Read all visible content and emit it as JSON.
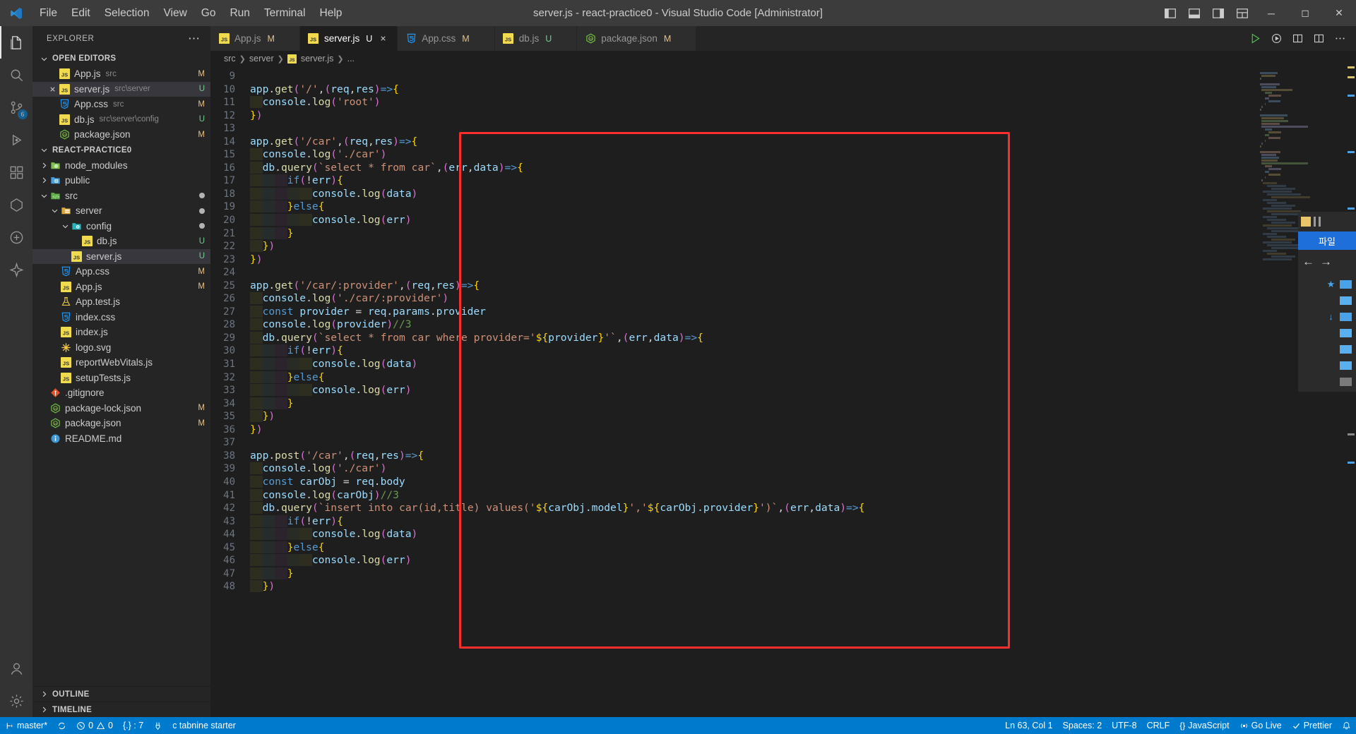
{
  "titlebar": {
    "logo_icon": "vscode-logo-icon",
    "menus": [
      "File",
      "Edit",
      "Selection",
      "View",
      "Go",
      "Run",
      "Terminal",
      "Help"
    ],
    "window_title": "server.js - react-practice0 - Visual Studio Code [Administrator]",
    "layout_icons": [
      "panel-left-icon",
      "panel-bottom-icon",
      "panel-right-icon",
      "layout-customize-icon"
    ],
    "window_controls": [
      "minimize",
      "maximize",
      "close"
    ]
  },
  "activitybar": {
    "items": [
      {
        "name": "explorer",
        "icon": "files-icon",
        "active": true,
        "badge": ""
      },
      {
        "name": "search",
        "icon": "search-icon",
        "active": false,
        "badge": ""
      },
      {
        "name": "source-control",
        "icon": "source-control-icon",
        "active": false,
        "badge": "6"
      },
      {
        "name": "run-and-debug",
        "icon": "debug-icon",
        "active": false,
        "badge": ""
      },
      {
        "name": "extensions",
        "icon": "extensions-icon",
        "active": false,
        "badge": ""
      },
      {
        "name": "remote-explorer",
        "icon": "remote-icon",
        "active": false,
        "badge": ""
      },
      {
        "name": "docker",
        "icon": "docker-icon",
        "active": false,
        "badge": ""
      },
      {
        "name": "tabnine",
        "icon": "sparkle-icon",
        "active": false,
        "badge": ""
      }
    ],
    "bottom": [
      {
        "name": "accounts",
        "icon": "account-icon"
      },
      {
        "name": "manage",
        "icon": "gear-icon"
      }
    ]
  },
  "sidebar": {
    "header": "EXPLORER",
    "more_actions": "⋯",
    "open_editors": {
      "label": "OPEN EDITORS",
      "expanded": true,
      "items": [
        {
          "name": "App.js",
          "desc": "src",
          "badge": "M",
          "badge_kind": "mod",
          "icon": "js-icon",
          "selected": false,
          "closable": false
        },
        {
          "name": "server.js",
          "desc": "src\\server",
          "badge": "U",
          "badge_kind": "unt",
          "icon": "js-icon",
          "selected": true,
          "closable": true
        },
        {
          "name": "App.css",
          "desc": "src",
          "badge": "M",
          "badge_kind": "mod",
          "icon": "css-icon",
          "selected": false,
          "closable": false
        },
        {
          "name": "db.js",
          "desc": "src\\server\\config",
          "badge": "U",
          "badge_kind": "unt",
          "icon": "js-icon",
          "selected": false,
          "closable": false
        },
        {
          "name": "package.json",
          "desc": "",
          "badge": "M",
          "badge_kind": "mod",
          "icon": "nodejs-icon",
          "selected": false,
          "closable": false
        }
      ]
    },
    "project": {
      "label": "REACT-PRACTICE0",
      "expanded": true,
      "tree": [
        {
          "name": "node_modules",
          "type": "folder",
          "indent": 1,
          "expanded": false,
          "icon": "folder-node-icon",
          "badge": ""
        },
        {
          "name": "public",
          "type": "folder",
          "indent": 1,
          "expanded": false,
          "icon": "folder-public-icon",
          "badge": ""
        },
        {
          "name": "src",
          "type": "folder",
          "indent": 1,
          "expanded": true,
          "icon": "folder-src-icon",
          "badge": "dot"
        },
        {
          "name": "server",
          "type": "folder",
          "indent": 2,
          "expanded": true,
          "icon": "folder-server-icon",
          "badge": "dot"
        },
        {
          "name": "config",
          "type": "folder",
          "indent": 3,
          "expanded": true,
          "icon": "folder-config-icon",
          "badge": "dot"
        },
        {
          "name": "db.js",
          "type": "file",
          "indent": 4,
          "icon": "js-icon",
          "badge": "U",
          "badge_kind": "unt"
        },
        {
          "name": "server.js",
          "type": "file",
          "indent": 3,
          "icon": "js-icon",
          "badge": "U",
          "badge_kind": "unt",
          "selected": true
        },
        {
          "name": "App.css",
          "type": "file",
          "indent": 2,
          "icon": "css-icon",
          "badge": "M",
          "badge_kind": "mod"
        },
        {
          "name": "App.js",
          "type": "file",
          "indent": 2,
          "icon": "js-icon",
          "badge": "M",
          "badge_kind": "mod"
        },
        {
          "name": "App.test.js",
          "type": "file",
          "indent": 2,
          "icon": "test-icon",
          "badge": ""
        },
        {
          "name": "index.css",
          "type": "file",
          "indent": 2,
          "icon": "css-icon",
          "badge": ""
        },
        {
          "name": "index.js",
          "type": "file",
          "indent": 2,
          "icon": "js-icon",
          "badge": ""
        },
        {
          "name": "logo.svg",
          "type": "file",
          "indent": 2,
          "icon": "svg-icon",
          "badge": ""
        },
        {
          "name": "reportWebVitals.js",
          "type": "file",
          "indent": 2,
          "icon": "js-icon",
          "badge": ""
        },
        {
          "name": "setupTests.js",
          "type": "file",
          "indent": 2,
          "icon": "js-icon",
          "badge": ""
        },
        {
          "name": ".gitignore",
          "type": "file",
          "indent": 1,
          "icon": "git-icon",
          "badge": ""
        },
        {
          "name": "package-lock.json",
          "type": "file",
          "indent": 1,
          "icon": "nodejs-icon",
          "badge": "M",
          "badge_kind": "mod"
        },
        {
          "name": "package.json",
          "type": "file",
          "indent": 1,
          "icon": "nodejs-icon",
          "badge": "M",
          "badge_kind": "mod"
        },
        {
          "name": "README.md",
          "type": "file",
          "indent": 1,
          "icon": "info-icon",
          "badge": ""
        }
      ]
    },
    "outline": "OUTLINE",
    "timeline": "TIMELINE"
  },
  "tabs": [
    {
      "label": "App.js",
      "icon": "js-icon",
      "badge": "M",
      "badge_kind": "m",
      "active": false,
      "closable": false
    },
    {
      "label": "server.js",
      "icon": "js-icon",
      "badge": "U",
      "badge_kind": "u",
      "active": true,
      "closable": true
    },
    {
      "label": "App.css",
      "icon": "css-icon",
      "badge": "M",
      "badge_kind": "m",
      "active": false,
      "closable": false
    },
    {
      "label": "db.js",
      "icon": "js-icon",
      "badge": "U",
      "badge_kind": "u",
      "active": false,
      "closable": false
    },
    {
      "label": "package.json",
      "icon": "nodejs-icon",
      "badge": "M",
      "badge_kind": "m",
      "active": false,
      "closable": false
    }
  ],
  "editor_actions": [
    "run-icon",
    "run-debug-icon",
    "split-terminal-icon",
    "split-editor-icon",
    "more-actions-icon"
  ],
  "breadcrumb": [
    "src",
    "server",
    "server.js",
    "..."
  ],
  "code": {
    "first_line": 9,
    "lines": [
      {
        "n": 9,
        "text": ""
      },
      {
        "n": 10,
        "text": "app.get('/',(req,res)=>{"
      },
      {
        "n": 11,
        "text": "  console.log('root')"
      },
      {
        "n": 12,
        "text": "})"
      },
      {
        "n": 13,
        "text": ""
      },
      {
        "n": 14,
        "text": "app.get('/car',(req,res)=>{"
      },
      {
        "n": 15,
        "text": "  console.log('./car')"
      },
      {
        "n": 16,
        "text": "  db.query(`select * from car`,(err,data)=>{"
      },
      {
        "n": 17,
        "text": "      if(!err){"
      },
      {
        "n": 18,
        "text": "          console.log(data)"
      },
      {
        "n": 19,
        "text": "      }else{"
      },
      {
        "n": 20,
        "text": "          console.log(err)"
      },
      {
        "n": 21,
        "text": "      }"
      },
      {
        "n": 22,
        "text": "  })"
      },
      {
        "n": 23,
        "text": "})"
      },
      {
        "n": 24,
        "text": ""
      },
      {
        "n": 25,
        "text": "app.get('/car/:provider',(req,res)=>{"
      },
      {
        "n": 26,
        "text": "  console.log('./car/:provider')"
      },
      {
        "n": 27,
        "text": "  const provider = req.params.provider"
      },
      {
        "n": 28,
        "text": "  console.log(provider)//3"
      },
      {
        "n": 29,
        "text": "  db.query(`select * from car where provider='${provider}'`,(err,data)=>{"
      },
      {
        "n": 30,
        "text": "      if(!err){"
      },
      {
        "n": 31,
        "text": "          console.log(data)"
      },
      {
        "n": 32,
        "text": "      }else{"
      },
      {
        "n": 33,
        "text": "          console.log(err)"
      },
      {
        "n": 34,
        "text": "      }"
      },
      {
        "n": 35,
        "text": "  })"
      },
      {
        "n": 36,
        "text": "})"
      },
      {
        "n": 37,
        "text": ""
      },
      {
        "n": 38,
        "text": "app.post('/car',(req,res)=>{"
      },
      {
        "n": 39,
        "text": "  console.log('./car')"
      },
      {
        "n": 40,
        "text": "  const carObj = req.body"
      },
      {
        "n": 41,
        "text": "  console.log(carObj)//3"
      },
      {
        "n": 42,
        "text": "  db.query(`insert into car(id,title) values('${carObj.model}','${carObj.provider}')`,(err,data)=>{"
      },
      {
        "n": 43,
        "text": "      if(!err){"
      },
      {
        "n": 44,
        "text": "          console.log(data)"
      },
      {
        "n": 45,
        "text": "      }else{"
      },
      {
        "n": 46,
        "text": "          console.log(err)"
      },
      {
        "n": 47,
        "text": "      }"
      },
      {
        "n": 48,
        "text": "  })"
      }
    ]
  },
  "rightpanel": {
    "title": "파일",
    "back_arrow": "←",
    "forward_arrow": "→"
  },
  "statusbar": {
    "left": [
      {
        "name": "remote-indicator",
        "icon": "",
        "label": ""
      },
      {
        "name": "branch",
        "icon": "git-branch-icon",
        "label": "master*"
      },
      {
        "name": "sync",
        "icon": "sync-icon",
        "label": ""
      },
      {
        "name": "problems",
        "icon": "error-warning-icon",
        "label": "0  0",
        "errors": "0",
        "warnings": "0"
      },
      {
        "name": "indentation-status",
        "icon": "brackets-icon",
        "label": "{.} : 7"
      },
      {
        "name": "ports",
        "icon": "ports-icon",
        "label": ""
      },
      {
        "name": "tabnine",
        "icon": "",
        "label": "c tabnine starter"
      }
    ],
    "right": [
      {
        "name": "cursor-position",
        "label": "Ln 63, Col 1"
      },
      {
        "name": "indentation",
        "label": "Spaces: 2"
      },
      {
        "name": "encoding",
        "label": "UTF-8"
      },
      {
        "name": "eol",
        "label": "CRLF"
      },
      {
        "name": "language-mode",
        "label": "JavaScript",
        "icon": "braces-icon"
      },
      {
        "name": "go-live",
        "label": "Go Live",
        "icon": "broadcast-icon"
      },
      {
        "name": "prettier",
        "label": "Prettier",
        "icon": "check-icon"
      },
      {
        "name": "notifications",
        "label": "",
        "icon": "bell-icon"
      }
    ]
  },
  "colors": {
    "accent": "#007acc",
    "titlebar_bg": "#3c3c3c",
    "sidebar_bg": "#252526",
    "editor_bg": "#1e1e1e",
    "activitybar_bg": "#333333",
    "annotation_red": "#fc2d2d",
    "modified_badge": "#e2c08d",
    "untracked_badge": "#73c991"
  }
}
